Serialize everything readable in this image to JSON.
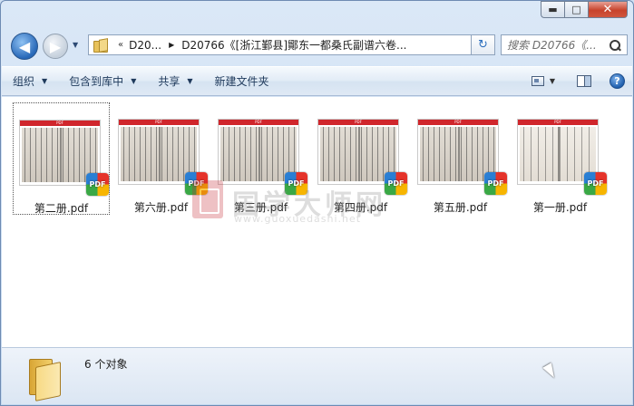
{
  "window": {
    "controls": {
      "minimize": "▬",
      "maximize": "□",
      "close": "✕"
    }
  },
  "nav": {
    "back_glyph": "◀",
    "forward_glyph": "▶",
    "breadcrumb": {
      "overflow": "«",
      "parent": "D20...",
      "current": "D20766《[浙江鄞县]鄮东一都桑氏副谱六卷..."
    },
    "refresh_glyph": "↻"
  },
  "search": {
    "placeholder": "搜索 D20766《..."
  },
  "toolbar": {
    "organize": "组织",
    "include_in_library": "包含到库中",
    "share": "共享",
    "new_folder": "新建文件夹",
    "help": "?"
  },
  "files": [
    {
      "name": "第二册.pdf",
      "selected": true
    },
    {
      "name": "第六册.pdf",
      "selected": false
    },
    {
      "name": "第三册.pdf",
      "selected": false
    },
    {
      "name": "第四册.pdf",
      "selected": false
    },
    {
      "name": "第五册.pdf",
      "selected": false
    },
    {
      "name": "第一册.pdf",
      "selected": false
    }
  ],
  "pdf_badge": "PDF",
  "thumb_header": "PDF",
  "watermark": {
    "title": "国学大师网",
    "url": "www.guoxuedashi.net"
  },
  "status": {
    "count_text": "6 个对象"
  },
  "colors": {
    "pdf_red": "#d0262c",
    "selection_border": "#555555",
    "toolbar_text": "#1e395b"
  }
}
